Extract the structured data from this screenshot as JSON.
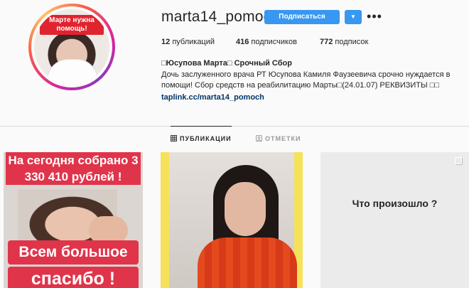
{
  "profile": {
    "username": "marta14_pomoch",
    "follow_label": "Подписаться",
    "dropdown_icon": "chevron-down-icon",
    "more_icon": "more-horizontal-icon",
    "avatar_sticker": "Марте нужна помощь!",
    "ring_colors": [
      "#d6249f",
      "#fd5949",
      "#fdc468",
      "#8a3ab9"
    ]
  },
  "stats": {
    "posts_count": "12",
    "posts_label": "публикаций",
    "followers_count": "416",
    "followers_label": "подписчиков",
    "following_count": "772",
    "following_label": "подписок"
  },
  "bio": {
    "name": "□Юсупова Марта□ Срочный Сбор",
    "text": "Дочь заслуженного врача РТ Юсупова Камиля Фаузеевича срочно нуждается в помощи! Сбор средств на реабилитацию Марты□(24.01.07) РЕКВИЗИТЫ □□",
    "link": "taplink.cc/marta14_pomoch"
  },
  "tabs": [
    {
      "label": "ПУБЛИКАЦИИ",
      "icon": "grid-icon",
      "active": true
    },
    {
      "label": "ОТМЕТКИ",
      "icon": "tagged-icon",
      "active": false
    }
  ],
  "posts": [
    {
      "top_text": "На сегодня собрано 3 330 410 рублей !",
      "mid_text": "Всем большое",
      "bottom_text": "спасибо !"
    },
    {
      "kind": "photo"
    },
    {
      "text": "Что произошло ?",
      "icon": "multiple-posts-icon"
    }
  ],
  "colors": {
    "accent": "#3897f0",
    "sticker_red": "#e0344a"
  }
}
